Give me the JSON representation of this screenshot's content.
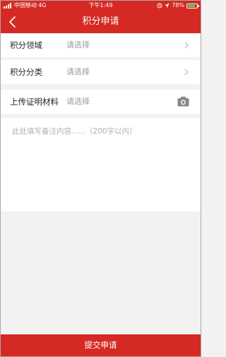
{
  "status_bar": {
    "carrier": "中国移动",
    "network": "4G",
    "time": "下午1:49",
    "battery": "78%",
    "icons": [
      "signal-icon",
      "lock-icon",
      "location-icon",
      "battery-icon"
    ]
  },
  "nav": {
    "title": "积分申请",
    "back_icon": "chevron-left-icon"
  },
  "form": {
    "fields": [
      {
        "label": "积分领域",
        "placeholder": "请选择",
        "icon": "chevron-right-icon"
      },
      {
        "label": "积分分类",
        "placeholder": "请选择",
        "icon": "chevron-right-icon"
      },
      {
        "label": "上传证明材料",
        "placeholder": "请选择",
        "icon": "camera-icon"
      }
    ],
    "note_placeholder": "此处填写备注内容......（200字以内）"
  },
  "submit_label": "提交申请",
  "colors": {
    "primary": "#d42a23",
    "background": "#f2f2f2",
    "placeholder": "#9a9a9a",
    "battery_charge": "#3ddc5a"
  }
}
